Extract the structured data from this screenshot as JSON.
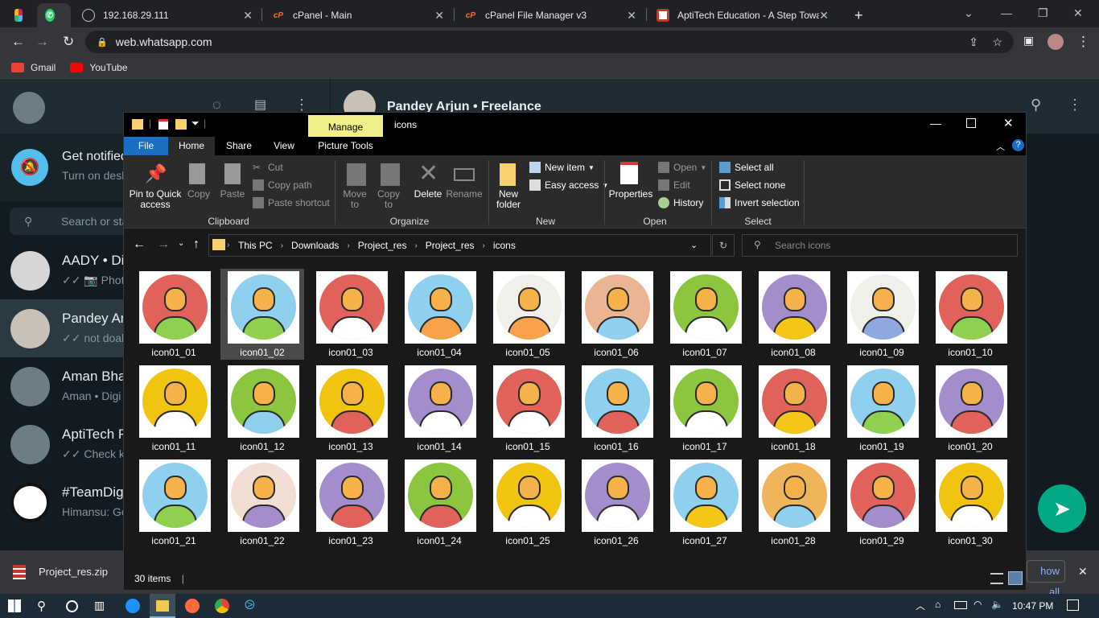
{
  "browser": {
    "tabs": [
      {
        "label": "",
        "icon": "slack-icon"
      },
      {
        "label": "",
        "icon": "whatsapp-icon"
      },
      {
        "label": "192.168.29.111",
        "icon": "globe-icon"
      },
      {
        "label": "cPanel - Main",
        "icon": "cpanel-icon"
      },
      {
        "label": "cPanel File Manager v3",
        "icon": "cpanel-icon"
      },
      {
        "label": "AptiTech Education - A Step Towa",
        "icon": "aptitech-icon"
      }
    ],
    "new_tab": "+",
    "url": "web.whatsapp.com",
    "bookmarks": [
      {
        "label": "Gmail",
        "color": "#ea4335"
      },
      {
        "label": "YouTube",
        "color": "#ff0000"
      }
    ]
  },
  "whatsapp": {
    "header_contact": "Pandey Arjun • Freelance",
    "notification_title": "Get notified",
    "notification_sub": "Turn on desk",
    "search_placeholder": "Search or sta",
    "chats": [
      {
        "name": "AADY • Di",
        "preview": "✓✓ 📷 Photo"
      },
      {
        "name": "Pandey Ar",
        "preview": "✓✓ not doab"
      },
      {
        "name": "Aman Bha",
        "preview": "Aman • Digi"
      },
      {
        "name": "AptiTech F",
        "preview": "✓✓ Check kr"
      },
      {
        "name": "#TeamDig",
        "preview": "Himansu: Go"
      }
    ],
    "show_all": "how all"
  },
  "download": {
    "filename": "Project_res.zip"
  },
  "explorer": {
    "title": "icons",
    "manage_label": "Manage",
    "tabs": {
      "file": "File",
      "home": "Home",
      "share": "Share",
      "view": "View",
      "picture_tools": "Picture Tools"
    },
    "ribbon": {
      "clipboard": {
        "pin": "Pin to Quick\naccess",
        "copy": "Copy",
        "paste": "Paste",
        "cut": "Cut",
        "copy_path": "Copy path",
        "paste_shortcut": "Paste shortcut",
        "group": "Clipboard"
      },
      "organize": {
        "move_to": "Move\nto",
        "copy_to": "Copy\nto",
        "delete": "Delete",
        "rename": "Rename",
        "group": "Organize"
      },
      "new": {
        "new_folder": "New\nfolder",
        "new_item": "New item",
        "easy_access": "Easy access",
        "group": "New"
      },
      "open": {
        "properties": "Properties",
        "open": "Open",
        "edit": "Edit",
        "history": "History",
        "group": "Open"
      },
      "select": {
        "select_all": "Select all",
        "select_none": "Select none",
        "invert": "Invert selection",
        "group": "Select"
      }
    },
    "path": [
      "This PC",
      "Downloads",
      "Project_res",
      "Project_res",
      "icons"
    ],
    "search_placeholder": "Search icons",
    "items": [
      {
        "name": "icon01_01",
        "bg": "#e0625a",
        "shirt": "#8fd14f"
      },
      {
        "name": "icon01_02",
        "bg": "#8fd0ee",
        "shirt": "#8fd14f"
      },
      {
        "name": "icon01_03",
        "bg": "#e0625a",
        "shirt": "#ffffff"
      },
      {
        "name": "icon01_04",
        "bg": "#8fd0ee",
        "shirt": "#f7a14a"
      },
      {
        "name": "icon01_05",
        "bg": "#f0efe9",
        "shirt": "#f7a14a"
      },
      {
        "name": "icon01_06",
        "bg": "#eab593",
        "shirt": "#8fd0ee"
      },
      {
        "name": "icon01_07",
        "bg": "#8cc63f",
        "shirt": "#ffffff"
      },
      {
        "name": "icon01_08",
        "bg": "#a38ecb",
        "shirt": "#f5c518"
      },
      {
        "name": "icon01_09",
        "bg": "#f0efe9",
        "shirt": "#8fa9e0"
      },
      {
        "name": "icon01_10",
        "bg": "#e0625a",
        "shirt": "#8fd14f"
      },
      {
        "name": "icon01_11",
        "bg": "#f1c40f",
        "shirt": "#ffffff"
      },
      {
        "name": "icon01_12",
        "bg": "#8cc63f",
        "shirt": "#8fd0ee"
      },
      {
        "name": "icon01_13",
        "bg": "#f1c40f",
        "shirt": "#e0625a"
      },
      {
        "name": "icon01_14",
        "bg": "#a38ecb",
        "shirt": "#ffffff"
      },
      {
        "name": "icon01_15",
        "bg": "#e0625a",
        "shirt": "#ffffff"
      },
      {
        "name": "icon01_16",
        "bg": "#8fd0ee",
        "shirt": "#e0625a"
      },
      {
        "name": "icon01_17",
        "bg": "#8cc63f",
        "shirt": "#ffffff"
      },
      {
        "name": "icon01_18",
        "bg": "#e0625a",
        "shirt": "#f5c518"
      },
      {
        "name": "icon01_19",
        "bg": "#8fd0ee",
        "shirt": "#8fd14f"
      },
      {
        "name": "icon01_20",
        "bg": "#a38ecb",
        "shirt": "#e0625a"
      },
      {
        "name": "icon01_21",
        "bg": "#8fd0ee",
        "shirt": "#8fd14f"
      },
      {
        "name": "icon01_22",
        "bg": "#f3ded4",
        "shirt": "#a38ecb"
      },
      {
        "name": "icon01_23",
        "bg": "#a38ecb",
        "shirt": "#e0625a"
      },
      {
        "name": "icon01_24",
        "bg": "#8cc63f",
        "shirt": "#e0625a"
      },
      {
        "name": "icon01_25",
        "bg": "#f1c40f",
        "shirt": "#ffffff"
      },
      {
        "name": "icon01_26",
        "bg": "#a38ecb",
        "shirt": "#ffffff"
      },
      {
        "name": "icon01_27",
        "bg": "#8fd0ee",
        "shirt": "#f5c518"
      },
      {
        "name": "icon01_28",
        "bg": "#f0b45a",
        "shirt": "#8fd0ee"
      },
      {
        "name": "icon01_29",
        "bg": "#e0625a",
        "shirt": "#a38ecb"
      },
      {
        "name": "icon01_30",
        "bg": "#f1c40f",
        "shirt": "#ffffff"
      }
    ],
    "selected_index": 1,
    "status": "30 items"
  },
  "taskbar": {
    "time": "10:47 PM"
  }
}
